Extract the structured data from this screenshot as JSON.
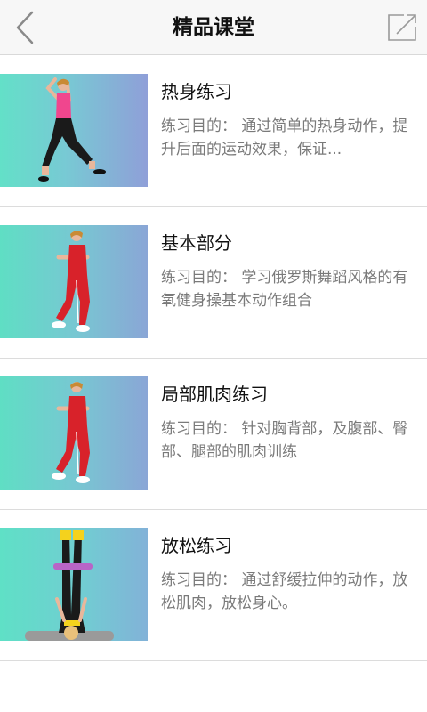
{
  "header": {
    "title": "精品课堂",
    "back_icon": "chevron-left-icon",
    "share_icon": "share-icon"
  },
  "lessons": [
    {
      "title": "热身练习",
      "desc": "练习目的： 通过简单的热身动作，提升后面的运动效果，保证..."
    },
    {
      "title": "基本部分",
      "desc": "练习目的： 学习俄罗斯舞蹈风格的有氧健身操基本动作组合"
    },
    {
      "title": "局部肌肉练习",
      "desc": "练习目的： 针对胸背部，及腹部、臀部、腿部的肌肉训练"
    },
    {
      "title": "放松练习",
      "desc": "练习目的： 通过舒缓拉伸的动作，放松肌肉，放松身心。"
    }
  ],
  "colors": {
    "header_bg": "#f7f7f7",
    "desc_text": "#7a7a7a",
    "divider": "#dcdcdc"
  }
}
